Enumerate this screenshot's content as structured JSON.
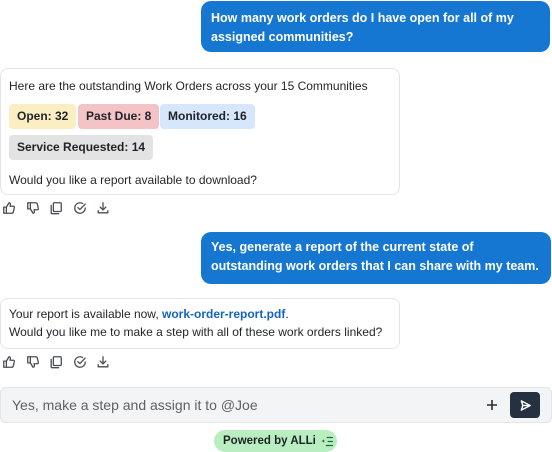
{
  "messages": {
    "user_1": "How many work orders do I have open for all of my assigned communities?",
    "bot_1": {
      "intro": "Here are the outstanding Work Orders across your 15 Communities",
      "chips": {
        "open": "Open: 32",
        "past_due": "Past Due: 8",
        "monitored": "Monitored: 16",
        "service_requested": "Service Requested: 14"
      },
      "question": "Would you like a report available to download?"
    },
    "user_2": "Yes, generate a report of the current state of outstanding work orders that I can share with my team.",
    "bot_2": {
      "prefix": "Your report is available now, ",
      "link": "work-order-report.pdf",
      "suffix": ".",
      "line2": "Would you like me to make a step with all of these work orders linked?"
    }
  },
  "action_icons": [
    "thumbs-up-icon",
    "thumbs-down-icon",
    "copy-icon",
    "check-circle-icon",
    "download-icon"
  ],
  "composer": {
    "value": "Yes, make a step and assign it to @Joe"
  },
  "footer": {
    "powered_by": "Powered by ALLi"
  },
  "colors": {
    "user_bubble": "#1677d2",
    "link": "#1463c4",
    "chip_open": "#fbeec3",
    "chip_past_due": "#f4c3c6",
    "chip_monitored": "#d6e6fb",
    "chip_service": "#e3e3e3",
    "send_button": "#253041",
    "powered_badge": "#b9efc0"
  }
}
